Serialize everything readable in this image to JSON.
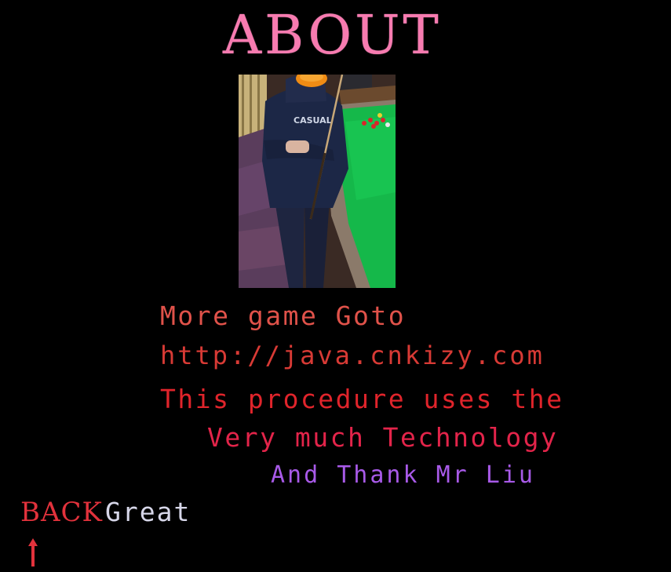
{
  "screen": {
    "title": "ABOUT",
    "photo": "player-holding-cue-at-snooker-table",
    "lines": [
      "More game Goto",
      "http://java.cnkizy.com",
      "This procedure uses the",
      "Very much Technology",
      "And Thank Mr Liu"
    ]
  },
  "menu": {
    "back_label": "BACK",
    "great_label": "Great",
    "cursor_icon": "up-arrow-icon"
  },
  "colors": {
    "background": "#000000",
    "title": "#f77bb0",
    "text_red": "#e0242b",
    "text_purple": "#a85ae8",
    "menu_selected": "#e2323c",
    "menu_unselected": "#d6d6e8"
  }
}
